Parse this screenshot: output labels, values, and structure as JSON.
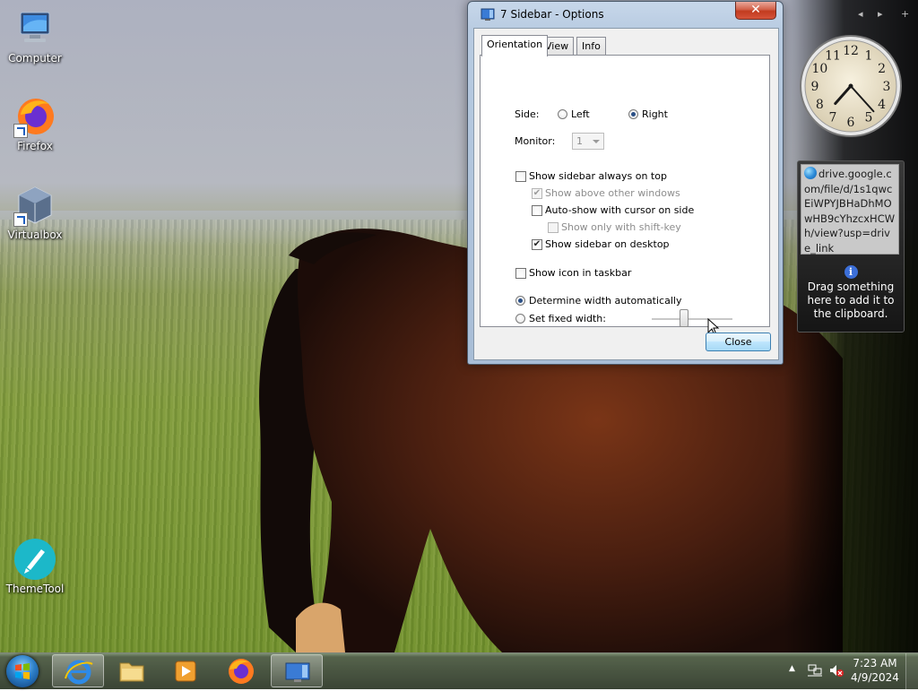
{
  "desktop": {
    "icons": [
      {
        "label": "Computer",
        "icon": "computer-icon"
      },
      {
        "label": "Firefox",
        "icon": "firefox-icon"
      },
      {
        "label": "Virtualbox",
        "icon": "virtualbox-icon"
      },
      {
        "label": "ThemeTool",
        "icon": "themetool-icon"
      }
    ]
  },
  "window": {
    "title": "7 Sidebar - Options",
    "close_glyph": "✕",
    "tabs": [
      "Orientation",
      "View",
      "Info"
    ],
    "active_tab": "Orientation",
    "side": {
      "label": "Side:",
      "left": "Left",
      "right": "Right",
      "selected": "Right"
    },
    "monitor": {
      "label": "Monitor:",
      "value": "1"
    },
    "options": {
      "always_on_top": {
        "label": "Show sidebar always on top",
        "checked": false
      },
      "above_other_windows": {
        "label": "Show above other windows",
        "checked": true,
        "disabled": true
      },
      "auto_show": {
        "label": "Auto-show with cursor on side",
        "checked": false
      },
      "shift_key": {
        "label": "Show only with shift-key",
        "checked": false,
        "disabled": true
      },
      "on_desktop": {
        "label": "Show sidebar on desktop",
        "checked": true
      },
      "taskbar_icon": {
        "label": "Show icon in taskbar",
        "checked": false
      }
    },
    "width": {
      "auto_label": "Determine width automatically",
      "fixed_label": "Set fixed width:",
      "selected": "auto",
      "slider_fraction": 0.4
    },
    "close_button": "Close"
  },
  "sidebar": {
    "controls": [
      "◂",
      "▸",
      "+"
    ],
    "clock": {
      "numbers": [
        "12",
        "1",
        "2",
        "3",
        "4",
        "5",
        "6",
        "7",
        "8",
        "9",
        "10",
        "11"
      ],
      "hour": 7,
      "minute": 23
    },
    "clipboard": {
      "item_text": "drive.google.com/file/d/1s1qwcEiWPYJBHaDhMOwHB9cYhzcxHCWh/view?usp=drive_link",
      "help_text": "Drag something here to add it to the clipboard."
    }
  },
  "taskbar": {
    "time": "7:23 AM",
    "date": "4/9/2024",
    "apps": [
      "internet-explorer-icon",
      "file-explorer-icon",
      "media-player-icon",
      "firefox-icon",
      "sidebar-app-icon"
    ]
  },
  "colors": {
    "accent": "#2a4f86",
    "close_red": "#c23b1f"
  }
}
